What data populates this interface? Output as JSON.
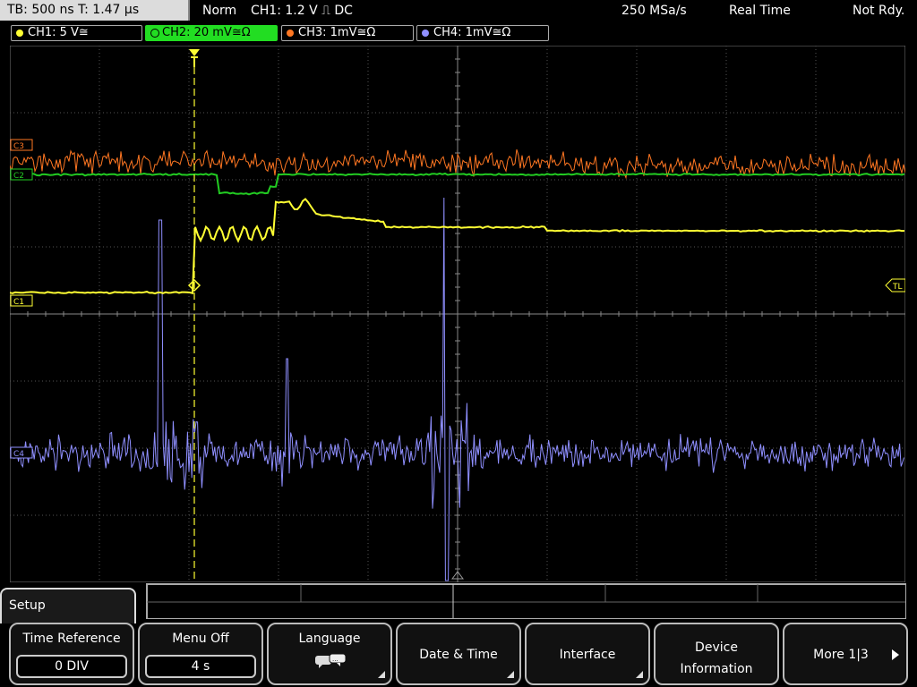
{
  "topbar": {
    "timebase": "TB: 500 ns   T: 1.47 µs",
    "trigger_mode": "Norm",
    "trigger_info": "CH1: 1.2 V ⎍ DC",
    "sample_rate": "250 MSa/s",
    "acq_mode": "Real Time",
    "trigger_status": "Not Rdy."
  },
  "channels": [
    {
      "label": "CH1: 5 V≅",
      "color": "#ffff33",
      "active": false
    },
    {
      "label": "CH2: 20 mV≅Ω",
      "color": "#22cc22",
      "active": true
    },
    {
      "label": "CH3: 1mV≅Ω",
      "color": "#ff7722",
      "active": false
    },
    {
      "label": "CH4: 1mV≅Ω",
      "color": "#8f8fff",
      "active": false
    }
  ],
  "markers": {
    "ch1": "C1",
    "ch2": "C2",
    "ch3": "C3",
    "ch4": "C4",
    "trigger_level": "TL"
  },
  "colors": {
    "ch1": "#ffff33",
    "ch2": "#22cc22",
    "ch3": "#ff7722",
    "ch4": "#8f8fff",
    "grid": "#555555"
  },
  "menu": {
    "title": "Setup",
    "softkeys": [
      {
        "label": "Time Reference",
        "value": "0 DIV"
      },
      {
        "label": "Menu Off",
        "value": "4 s"
      },
      {
        "label": "Language",
        "icon": "speech-bubbles-icon"
      },
      {
        "label": "Date & Time"
      },
      {
        "label": "Interface"
      },
      {
        "label": "Device Information"
      },
      {
        "label": "More 1|3",
        "icon": "arrow-right-icon"
      }
    ]
  }
}
